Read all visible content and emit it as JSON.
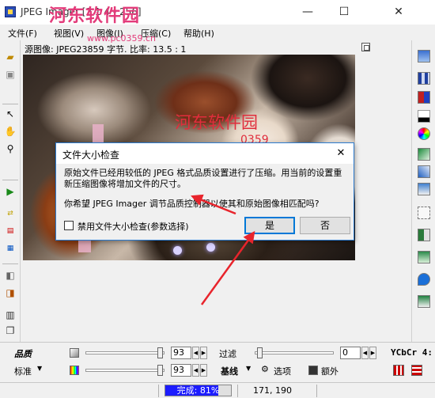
{
  "window": {
    "title": "JPEG Imager [2 1 4 - 256]",
    "watermark": "河东软件园",
    "watermark_url": "www.pc0359.cn",
    "min_glyph": "—",
    "max_glyph": "☐",
    "close_glyph": "✕"
  },
  "menu": [
    {
      "label": "文件(F)"
    },
    {
      "label": "视图(V)"
    },
    {
      "label": "图像(I)"
    },
    {
      "label": "压缩(C)"
    },
    {
      "label": "帮助(H)"
    }
  ],
  "image_panel": {
    "info": "源图像:  JPEG23859 字节.   比率: 13.5 : 1",
    "overlay_watermark": "河东软件园",
    "overlay_watermark_small": "0359"
  },
  "dialog": {
    "title": "文件大小检查",
    "close_glyph": "✕",
    "message": "原始文件已经用较低的 JPEG 格式品质设置进行了压缩。用当前的设置重新压缩图像将增加文件的尺寸。",
    "question": "你希望 JPEG Imager 调节品质控制器以使其和原始图像相匹配吗?",
    "checkbox_label": "禁用文件大小检查(参数选择)",
    "checkbox_checked": false,
    "yes_label": "是",
    "no_label": "否"
  },
  "annotation": {
    "arrow_color": "#e8242c"
  },
  "controls": {
    "quality_label": "品质",
    "preset_label": "标准",
    "quality_value": "93",
    "quality_value2": "93",
    "filter_label": "过滤",
    "filter_value": "0",
    "baseline_label": "基线",
    "options_label": "选项",
    "extra_label": "额外",
    "ycbcr_label": "YCbCr 4:"
  },
  "status": {
    "progress_text": "完成: 81%",
    "progress_percent": 81,
    "coords": "171, 190"
  },
  "icons": {
    "left_toolbar": [
      "open-folder-icon",
      "save-icon",
      "pointer-icon",
      "hand-icon",
      "zoom-icon",
      "play-icon",
      "convert-icon",
      "jpeg-icon",
      "gif-icon",
      "back-icon",
      "forward-icon",
      "batch-icon",
      "copy-icon"
    ],
    "right_toolbar": [
      "window-icon",
      "grid-icon",
      "compare-icon",
      "histogram-icon",
      "color-wheel-icon",
      "rotate-icon",
      "flip-icon",
      "crop-icon",
      "adjust-icon",
      "split-icon",
      "layer-icon",
      "drop-icon",
      "export-icon"
    ]
  }
}
